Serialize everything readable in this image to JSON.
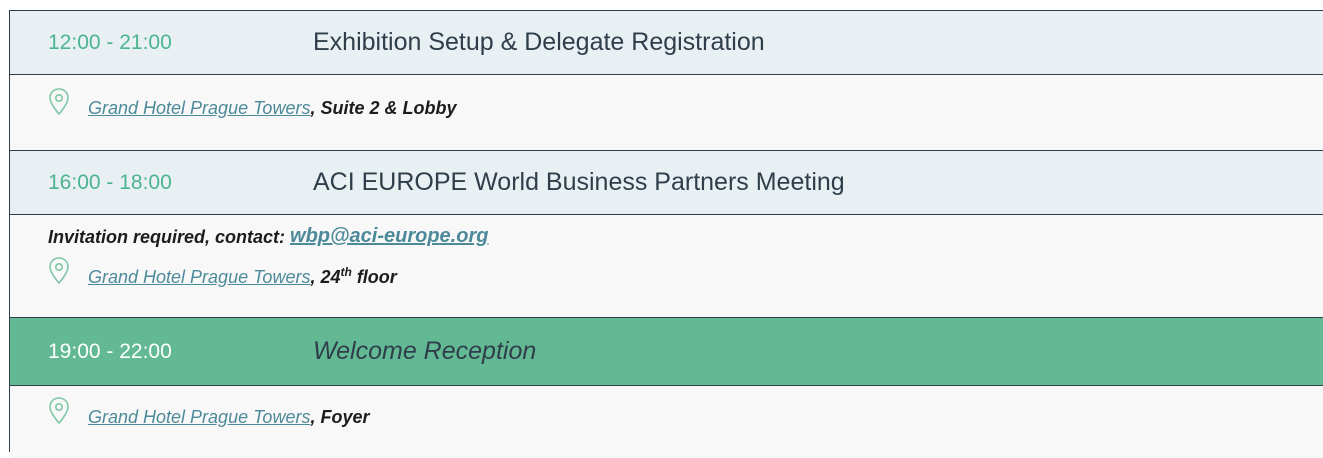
{
  "colors": {
    "header_bg": "#e8f0f4",
    "highlight_bg": "#62b994",
    "time_text": "#4cb48f",
    "link": "#4d8a99",
    "detail_bg": "#f8f8f8"
  },
  "sessions": [
    {
      "time": "12:00 - 21:00",
      "title": "Exhibition Setup & Delegate Registration",
      "location_link": "Grand Hotel Prague Towers",
      "location_rest": ", Suite 2 & Lobby"
    },
    {
      "time": "16:00 - 18:00",
      "title": "ACI EUROPE World Business Partners Meeting",
      "note_prefix": "Invitation required, contact: ",
      "note_email": "wbp@aci-europe.org",
      "location_link": "Grand Hotel Prague Towers",
      "location_rest_prefix": ", 24",
      "location_sup": "th",
      "location_rest_suffix": " floor"
    },
    {
      "time": "19:00 - 22:00",
      "title": "Welcome Reception",
      "location_link": "Grand Hotel Prague Towers",
      "location_rest": ", Foyer"
    }
  ],
  "icons": {
    "location": "map-pin-icon"
  }
}
